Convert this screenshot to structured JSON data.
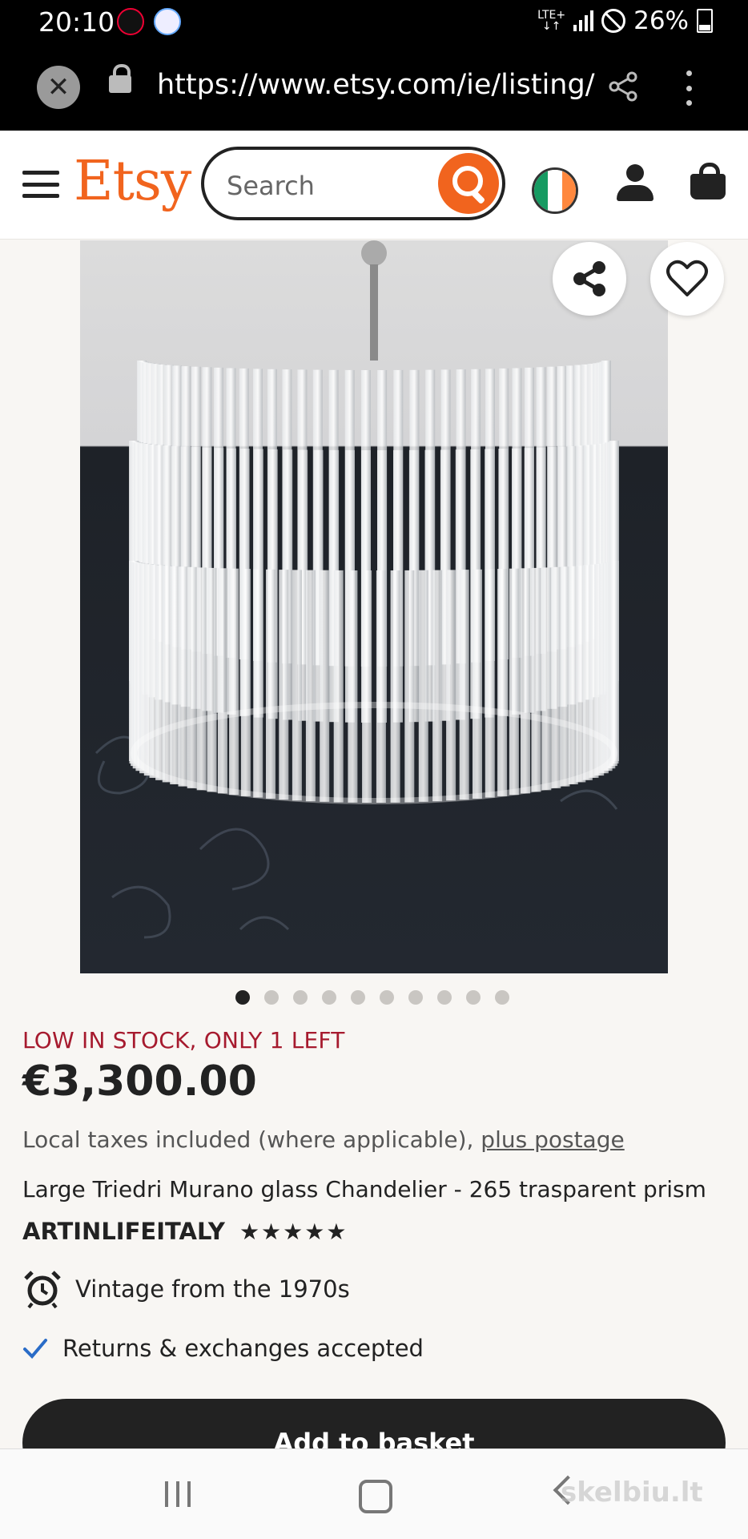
{
  "status_bar": {
    "time": "20:10",
    "network": "LTE+",
    "battery": "26%"
  },
  "browser": {
    "url": "https://www.etsy.com/ie/listing/"
  },
  "header": {
    "logo": "Etsy",
    "search_placeholder": "Search",
    "brand_color": "#f1641e"
  },
  "gallery": {
    "image_count": 10,
    "active_index": 0
  },
  "product": {
    "stock_notice": "LOW IN STOCK, ONLY 1 LEFT",
    "price": "€3,300.00",
    "taxes_text": "Local taxes included (where applicable), ",
    "postage_link": "plus postage",
    "title": "Large Triedri Murano glass Chandelier - 265 trasparent prism",
    "shop_name": "ARTINLIFEITALY",
    "rating_stars": "★★★★★",
    "vintage_text": "Vintage from the 1970s",
    "returns_text": "Returns & exchanges accepted",
    "add_to_basket_label": "Add to basket"
  },
  "watermark": "skelbiu.lt",
  "colors": {
    "stock_red": "#a61a2e",
    "check_blue": "#2a6cc7",
    "dark": "#222222"
  }
}
